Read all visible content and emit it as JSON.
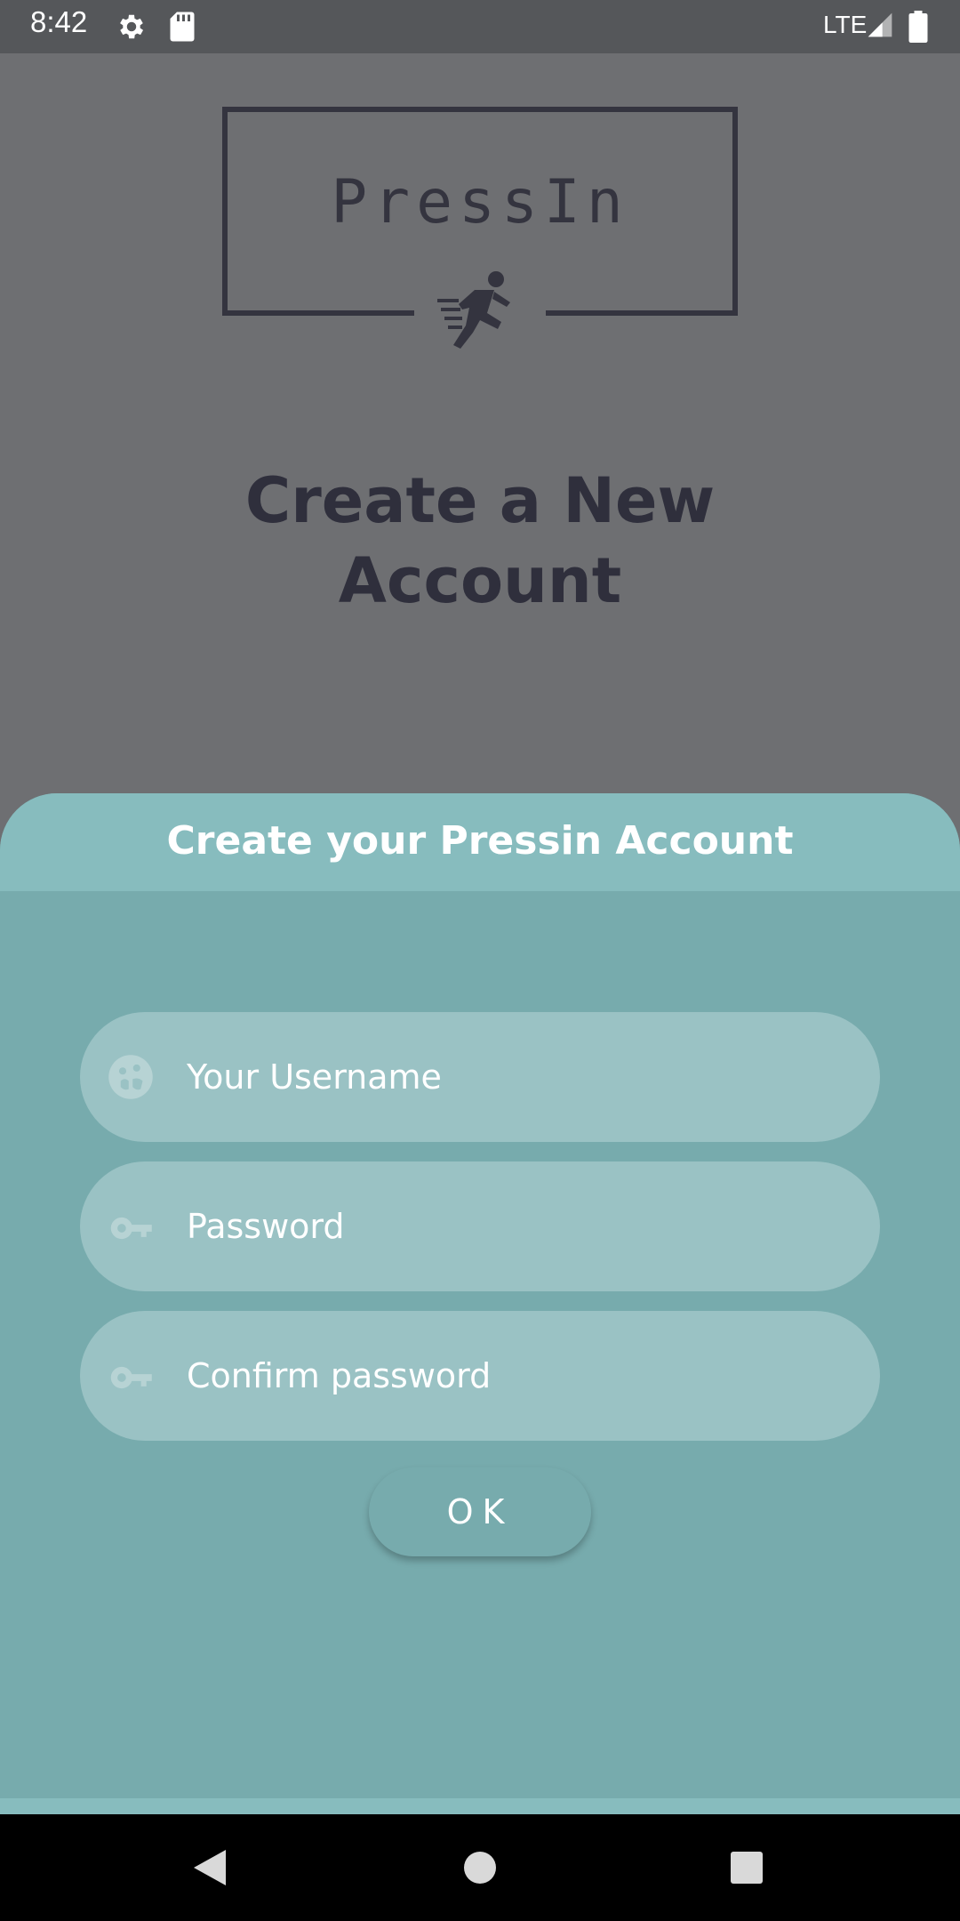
{
  "status_bar": {
    "time": "8:42",
    "network": "LTE",
    "icons": [
      "gear-icon",
      "sd-card-icon",
      "signal-icon",
      "battery-icon"
    ]
  },
  "logo": {
    "text": "PressIn",
    "icon": "running-man-icon"
  },
  "page_title": {
    "line1": "Create a New",
    "line2": "Account"
  },
  "sheet": {
    "title": "Create your Pressin Account",
    "fields": [
      {
        "placeholder": "Your Username",
        "icon": "face-icon"
      },
      {
        "placeholder": "Password",
        "icon": "key-icon"
      },
      {
        "placeholder": "Confirm password",
        "icon": "key-icon"
      }
    ],
    "ok_label": "OK"
  },
  "nav_bar": {
    "buttons": [
      "back-icon",
      "home-icon",
      "recents-icon"
    ]
  },
  "colors": {
    "sheet_bg": "#77abad",
    "sheet_header": "#87bcbe",
    "field_bg": "#9ac2c4",
    "scrim": "#6e6f72",
    "title_text": "#2f2f3c"
  }
}
